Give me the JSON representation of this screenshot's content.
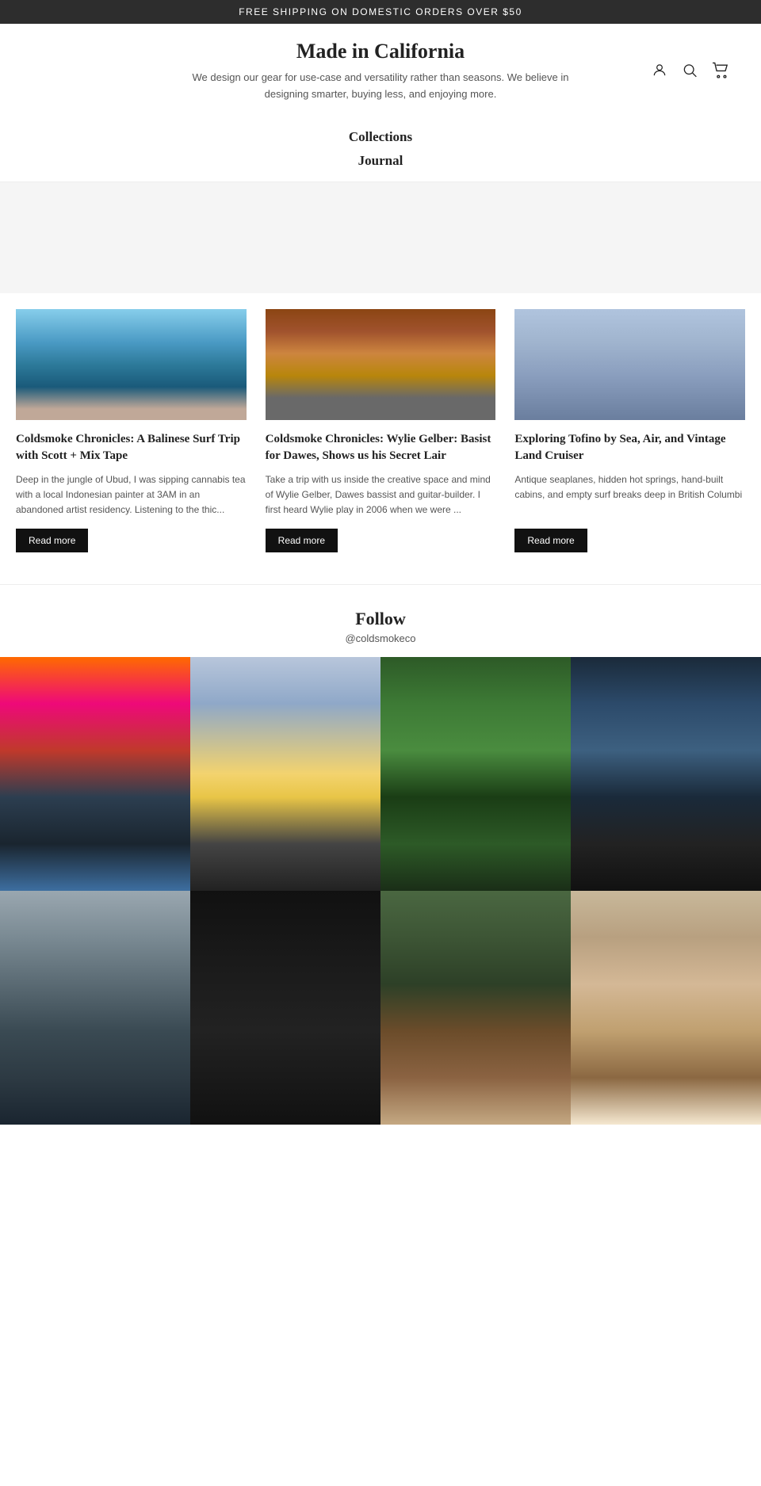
{
  "announcement": {
    "text": "FREE SHIPPING ON DOMESTIC ORDERS OVER $50"
  },
  "header": {
    "brand_name": "Made in California",
    "tagline": "We design our gear for use-case and versatility rather than seasons. We believe in designing smarter, buying less, and enjoying more.",
    "icons": {
      "account": "👤",
      "search": "🔍",
      "cart": "🛒"
    }
  },
  "nav": {
    "items": [
      {
        "label": "Collections"
      },
      {
        "label": "Journal"
      }
    ]
  },
  "blog": {
    "posts": [
      {
        "title": "Coldsmoke Chronicles: A Balinese Surf Trip with Scott + Mix Tape",
        "excerpt": "Deep in the jungle of Ubud, I was sipping cannabis tea with a local Indonesian painter at 3AM in an abandoned artist residency. Listening to the thic...",
        "read_more": "Read more"
      },
      {
        "title": "Coldsmoke Chronicles: Wylie Gelber: Basist for Dawes, Shows us his Secret Lair",
        "excerpt": "Take a trip with us inside the creative space and mind of Wylie Gelber, Dawes bassist and guitar-builder. I first heard Wylie play in 2006 when we were ...",
        "read_more": "Read more"
      },
      {
        "title": "Exploring Tofino by Sea, Air, and Vintage Land Cruiser",
        "excerpt": "Antique seaplanes, hidden hot springs, hand-built cabins, and empty surf breaks deep in British Columbi",
        "read_more": "Read more"
      }
    ]
  },
  "follow": {
    "title": "Follow",
    "handle": "@coldsmokeco"
  },
  "instagram": {
    "grid": [
      {
        "id": 1,
        "class": "img-mountains-fire"
      },
      {
        "id": 2,
        "class": "img-car-interior"
      },
      {
        "id": 3,
        "class": "img-forest-cabin"
      },
      {
        "id": 4,
        "class": "img-hat-person"
      },
      {
        "id": 5,
        "class": "img-rainy-vehicle"
      },
      {
        "id": 6,
        "class": "img-dark-room"
      },
      {
        "id": 7,
        "class": "img-tree-landscape"
      },
      {
        "id": 8,
        "class": "img-cliff-coast"
      }
    ]
  }
}
